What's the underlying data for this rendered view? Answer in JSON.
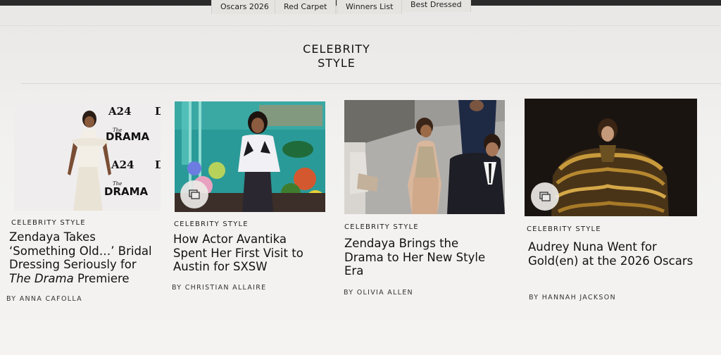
{
  "nav": {
    "tabs": [
      "Oscars 2026",
      "Red Carpet",
      "Winners List",
      "Best Dressed"
    ]
  },
  "section": {
    "title_line1": "CELEBRITY",
    "title_line2": "STYLE"
  },
  "cards": [
    {
      "kicker": "CELEBRITY STYLE",
      "headline_a": "Zendaya Takes ‘Something Old…’ Bridal Dressing Seriously for ",
      "headline_em1": "The Drama",
      "headline_b": " Premiere",
      "byline": "BY ANNA CAFOLLA",
      "thumb_text": [
        "A24",
        "The",
        "DRAMA",
        "A24",
        "The",
        "DRAMA"
      ],
      "has_gallery_icon": false
    },
    {
      "kicker": "CELEBRITY STYLE",
      "headline": "How Actor Avantika Spent Her First Visit to Austin for SXSW",
      "byline": "BY CHRISTIAN ALLAIRE",
      "has_gallery_icon": true
    },
    {
      "kicker": "CELEBRITY STYLE",
      "headline": "Zendaya Brings the Drama to Her New Style Era",
      "byline": "BY OLIVIA ALLEN",
      "has_gallery_icon": false
    },
    {
      "kicker": "CELEBRITY STYLE",
      "headline": "Audrey Nuna Went for Gold(en) at the 2026 Oscars",
      "byline": "BY HANNAH JACKSON",
      "has_gallery_icon": true
    }
  ],
  "icons": {
    "gallery": "gallery-icon"
  }
}
